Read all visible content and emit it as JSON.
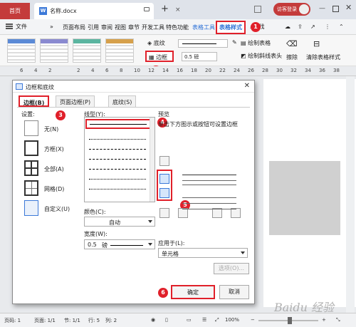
{
  "titlebar": {
    "home_tab": "首页",
    "doc_tab": "名称.docx",
    "login": "访客登录"
  },
  "menubar": {
    "file": "文件",
    "items": [
      "页面布局",
      "引用",
      "审阅",
      "视图",
      "章节",
      "开发工具",
      "特色功能",
      "表格工具"
    ],
    "active_tab": "表格样式",
    "search": "查找"
  },
  "ribbon": {
    "shading": "底纹",
    "border": "边框",
    "line_width": "0.5",
    "line_width_unit": "磅",
    "draw_table": "绘制表格",
    "draw_diagonal": "绘制斜线表头",
    "erase": "擦除",
    "clear_style": "清除表格样式",
    "swatch_colors": [
      "#5b8ad6",
      "#e06b5b",
      "#8a8ad0",
      "#5bb5a0",
      "#d6a04b",
      "#7b5bd6"
    ]
  },
  "ruler": {
    "ticks": [
      "6",
      "4",
      "2",
      "",
      "2",
      "4",
      "6",
      "8",
      "10",
      "12",
      "14",
      "16",
      "18",
      "20",
      "22",
      "24",
      "26",
      "28",
      "30",
      "32",
      "34",
      "36",
      "38"
    ]
  },
  "dialog": {
    "title": "边框和底纹",
    "tabs": [
      "边框(B)",
      "页面边框(P)",
      "底纹(S)"
    ],
    "settings_label": "设置:",
    "settings": [
      "无(N)",
      "方框(X)",
      "全部(A)",
      "网格(D)",
      "自定义(U)"
    ],
    "line_style_label": "线型(Y):",
    "color_label": "颜色(C):",
    "color_value": "自动",
    "width_label": "宽度(W):",
    "width_value": "0.5",
    "width_unit": "磅",
    "preview_label": "预览",
    "preview_hint": "单击下方图示或按钮可设置边框",
    "apply_label": "应用于(L):",
    "apply_value": "单元格",
    "options_button": "选项(O)...",
    "ok": "确定",
    "cancel": "取消"
  },
  "markers": [
    "1",
    "2",
    "3",
    "4",
    "5",
    "6"
  ],
  "statusbar": {
    "page": "页码: 1",
    "pages": "页面: 1/1",
    "section": "节: 1/1",
    "row": "行: 5",
    "col": "列: 2",
    "zoom": "100%"
  },
  "watermark": "Baidu 经验",
  "colors": {
    "accent": "#c43b3b",
    "highlight": "#e0202a",
    "link": "#2a6fd6"
  }
}
